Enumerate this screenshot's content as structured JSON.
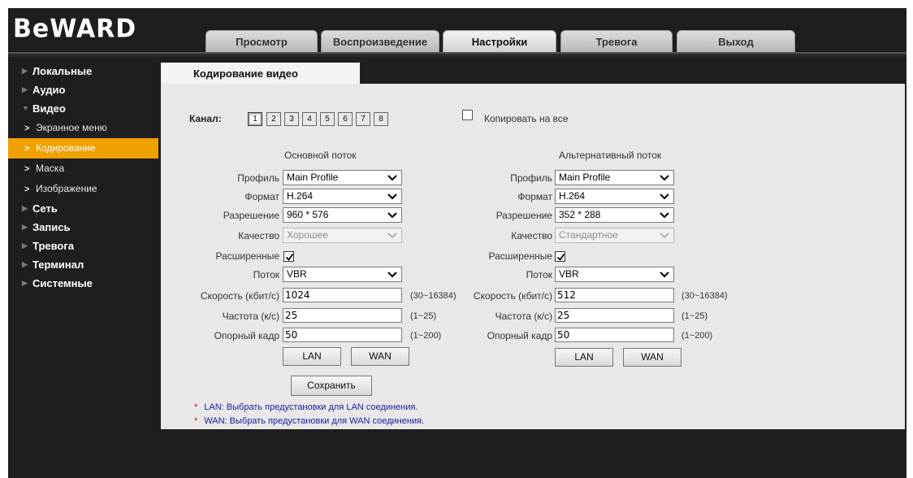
{
  "brand": {
    "logo": "BeWARD"
  },
  "top_tabs": [
    {
      "label": "Просмотр",
      "active": false
    },
    {
      "label": "Воспроизведение",
      "active": false
    },
    {
      "label": "Настройки",
      "active": true
    },
    {
      "label": "Тревога",
      "active": false
    },
    {
      "label": "Выход",
      "active": false
    }
  ],
  "sidebar": {
    "items": [
      {
        "label": "Локальные"
      },
      {
        "label": "Аудио"
      },
      {
        "label": "Видео",
        "expanded": true
      },
      {
        "label": "Экранное меню",
        "sub": true
      },
      {
        "label": "Кодирование",
        "sub": true,
        "active": true
      },
      {
        "label": "Маска",
        "sub": true
      },
      {
        "label": "Изображение",
        "sub": true
      },
      {
        "label": "Сеть"
      },
      {
        "label": "Запись"
      },
      {
        "label": "Тревога"
      },
      {
        "label": "Терминал"
      },
      {
        "label": "Системные"
      }
    ]
  },
  "content": {
    "tab_title": "Кодирование видео",
    "channel_label": "Канал:",
    "channels": [
      "1",
      "2",
      "3",
      "4",
      "5",
      "6",
      "7",
      "8"
    ],
    "selected_channel": "1",
    "copy_all_label": "Копировать на все",
    "copy_all_checked": false,
    "field_labels": {
      "profile": "Профиль",
      "format": "Формат",
      "resolution": "Разрешение",
      "quality": "Качество",
      "advanced": "Расширенные",
      "stream": "Поток",
      "bitrate": "Скорость (кбит/с)",
      "fps": "Частота (к/с)",
      "keyframe": "Опорный кадр"
    },
    "main_stream": {
      "title": "Основной поток",
      "profile": "Main Profile",
      "format": "H.264",
      "resolution": "960 * 576",
      "quality": "Хорошее",
      "advanced_checked": true,
      "stream": "VBR",
      "bitrate": "1024",
      "bitrate_range": "(30~16384)",
      "fps": "25",
      "fps_range": "(1~25)",
      "keyframe": "50",
      "keyframe_range": "(1~200)"
    },
    "alt_stream": {
      "title": "Альтернативный поток",
      "profile": "Main Profile",
      "format": "H.264",
      "resolution": "352 * 288",
      "quality": "Стандартное",
      "advanced_checked": true,
      "stream": "VBR",
      "bitrate": "512",
      "bitrate_range": "(30~16384)",
      "fps": "25",
      "fps_range": "(1~25)",
      "keyframe": "50",
      "keyframe_range": "(1~200)"
    },
    "lan_button": "LAN",
    "wan_button": "WAN",
    "save_button": "Сохранить",
    "notes": [
      "LAN: Выбрать предустановки для LAN соединения.",
      "WAN: Выбрать предустановки для WAN соединения."
    ],
    "note_marker": "*"
  },
  "colors": {
    "accent": "#f0a000",
    "background": "#1e1e1e",
    "panel": "#e8e8e8",
    "note_text": "#1a1aa0",
    "note_star": "#e00000"
  }
}
